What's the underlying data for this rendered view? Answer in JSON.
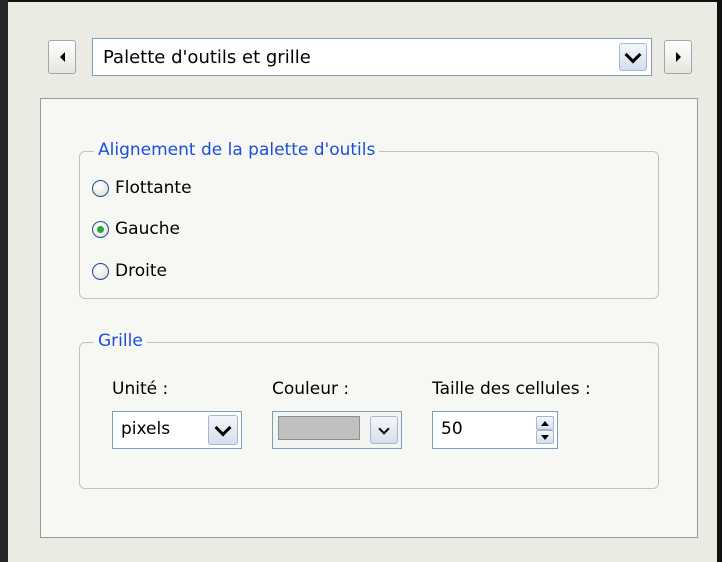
{
  "header": {
    "section_title": "Palette d'outils et grille"
  },
  "alignment_group": {
    "legend": "Alignement de la palette d'outils",
    "options": [
      {
        "label": "Flottante",
        "checked": false
      },
      {
        "label": "Gauche",
        "checked": true
      },
      {
        "label": "Droite",
        "checked": false
      }
    ]
  },
  "grid_group": {
    "legend": "Grille",
    "unit_label": "Unité :",
    "unit_value": "pixels",
    "color_label": "Couleur :",
    "color_value": "#c0c0c0",
    "cell_size_label": "Taille des cellules :",
    "cell_size_value": "50"
  },
  "icons": {
    "prev": "triangle-left-icon",
    "next": "triangle-right-icon",
    "dropdown": "chevron-down-icon",
    "spin_up": "triangle-up-icon",
    "spin_down": "triangle-down-icon"
  }
}
